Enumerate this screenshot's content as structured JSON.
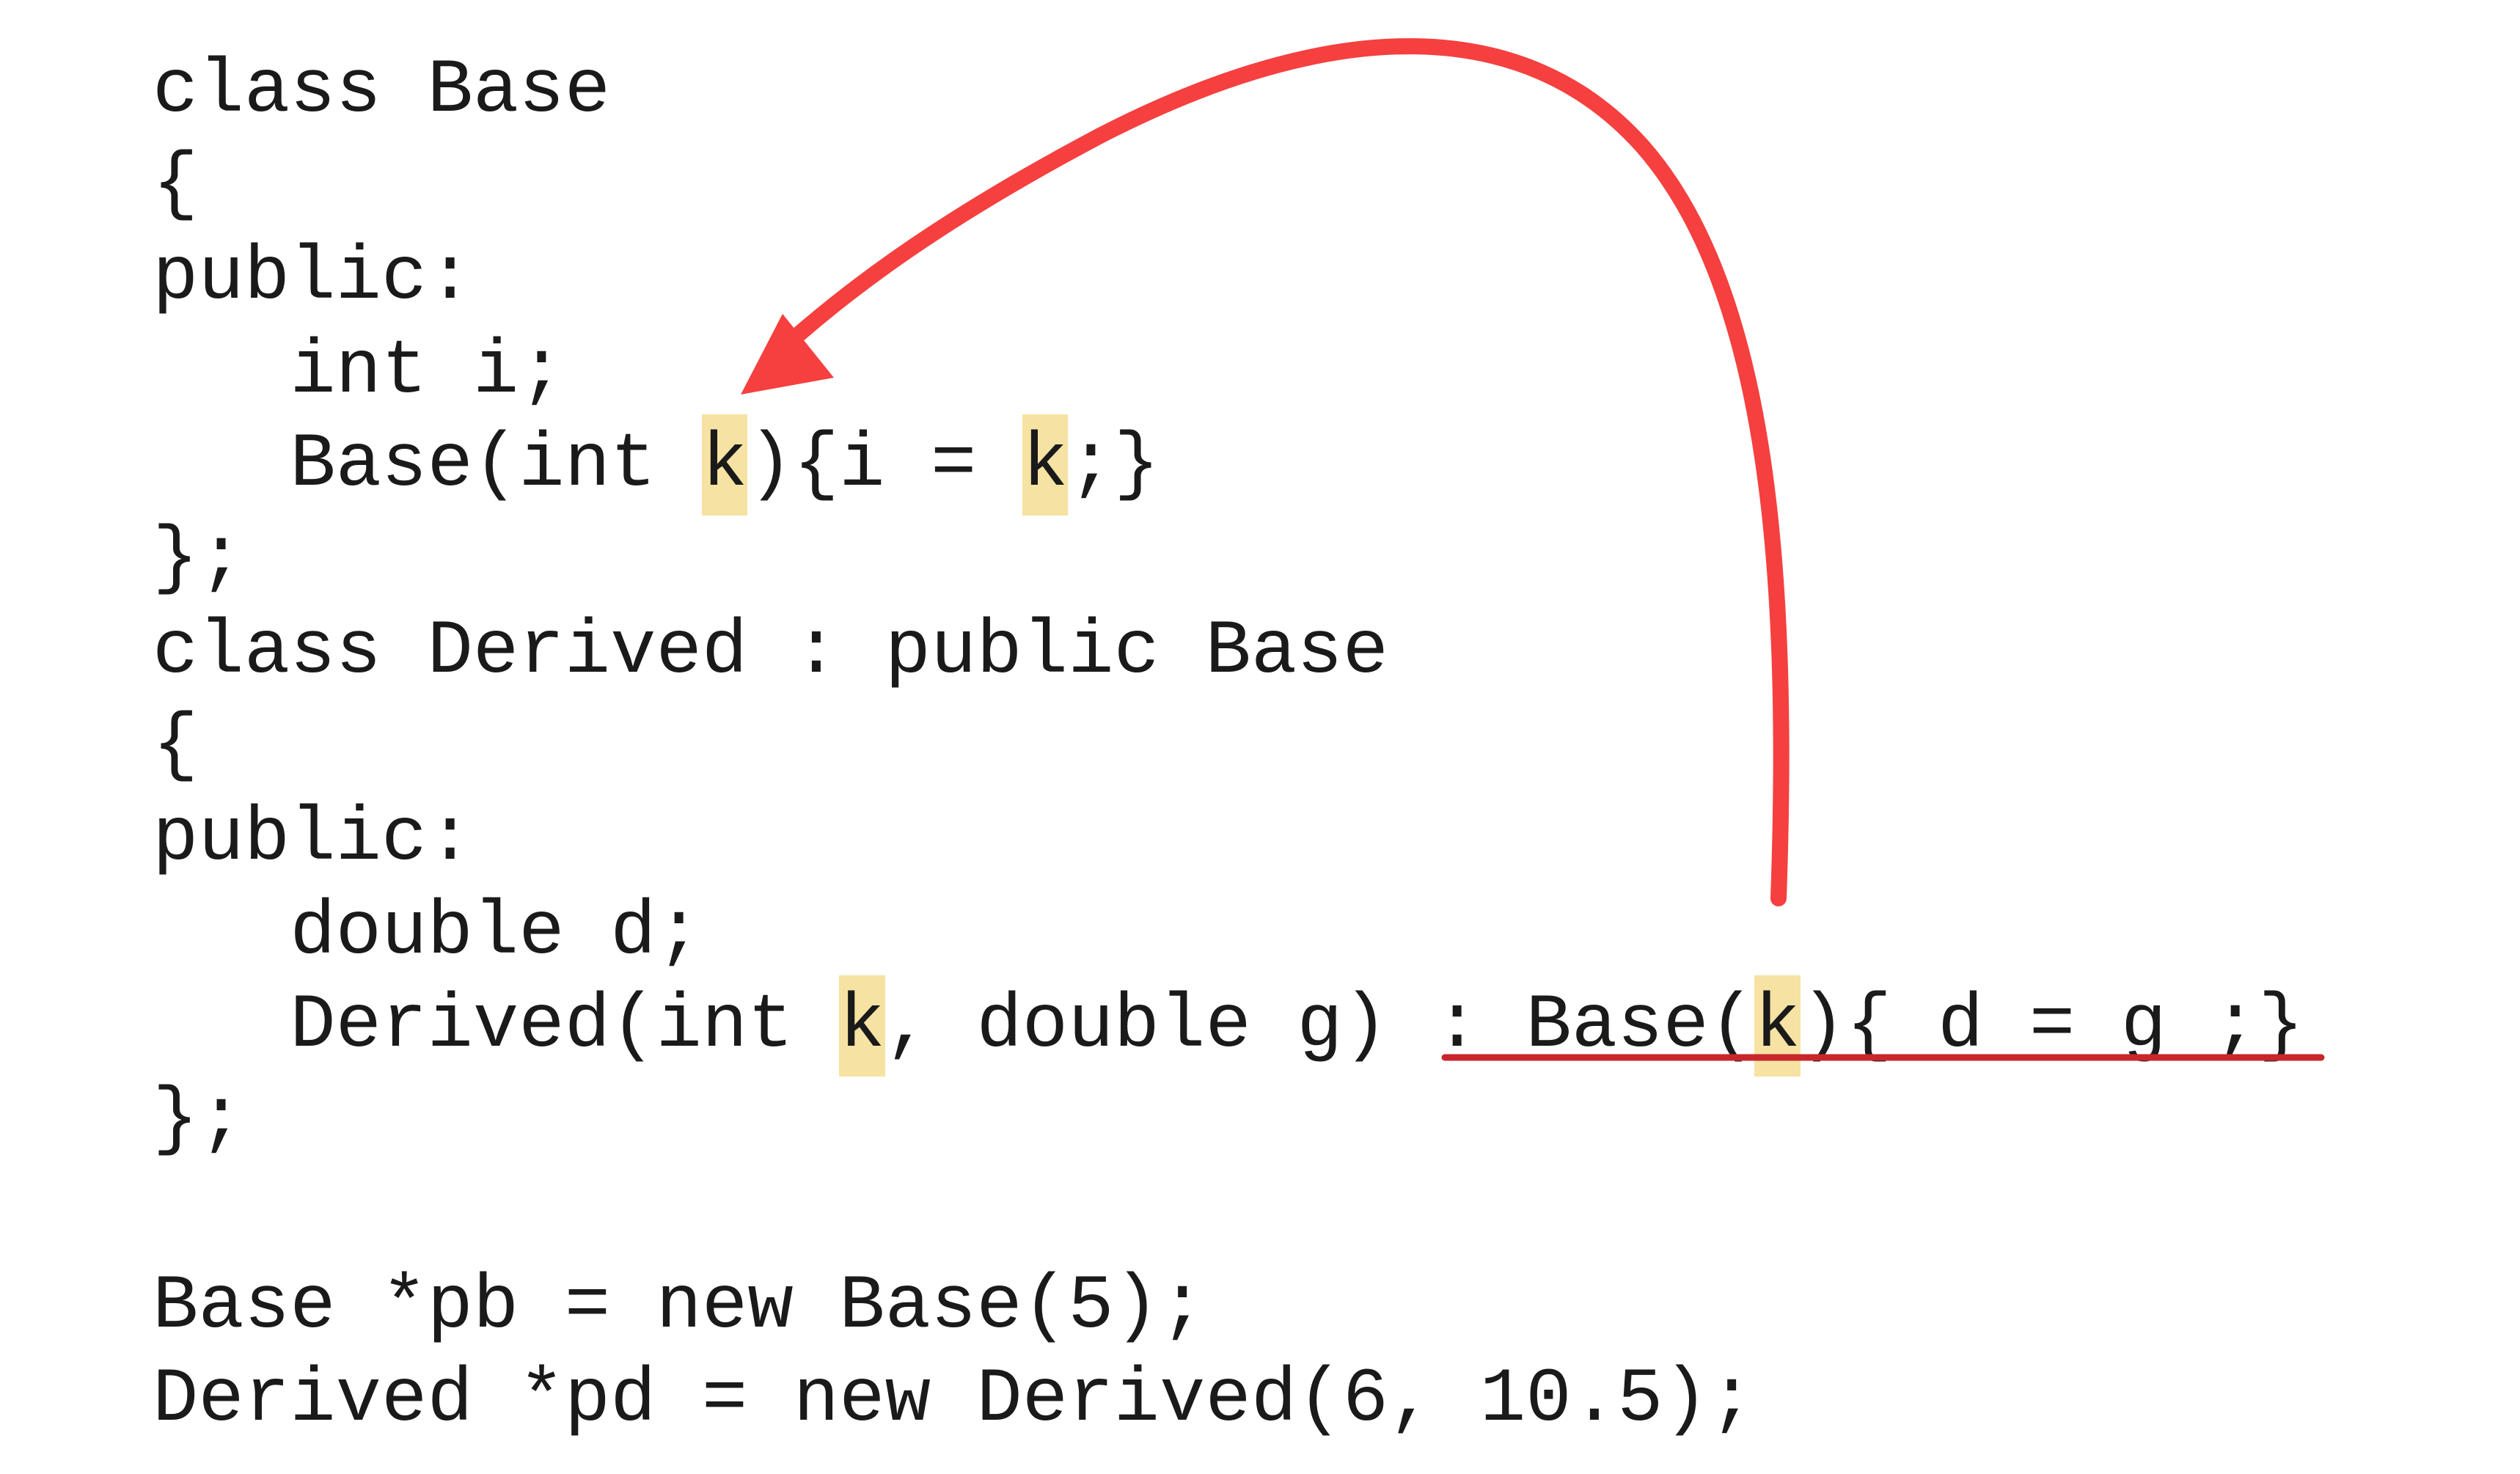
{
  "code": {
    "lines": [
      {
        "segments": [
          {
            "text": "class Base"
          }
        ]
      },
      {
        "segments": [
          {
            "text": "{"
          }
        ]
      },
      {
        "segments": [
          {
            "text": "public:"
          }
        ]
      },
      {
        "segments": [
          {
            "text": "   int i;"
          }
        ]
      },
      {
        "segments": [
          {
            "text": "   Base(int "
          },
          {
            "text": "k",
            "highlight": true
          },
          {
            "text": "){i = "
          },
          {
            "text": "k",
            "highlight": true
          },
          {
            "text": ";}"
          }
        ]
      },
      {
        "segments": [
          {
            "text": "};"
          }
        ]
      },
      {
        "segments": [
          {
            "text": "class Derived : public Base"
          }
        ]
      },
      {
        "segments": [
          {
            "text": "{"
          }
        ]
      },
      {
        "segments": [
          {
            "text": "public:"
          }
        ]
      },
      {
        "segments": [
          {
            "text": "   double d;"
          }
        ]
      },
      {
        "segments": [
          {
            "text": "   Derived(int "
          },
          {
            "text": "k",
            "highlight": true
          },
          {
            "text": ", double g) "
          },
          {
            "text": ": Base(",
            "underline": true
          },
          {
            "text": "k",
            "highlight": true,
            "underline": true
          },
          {
            "text": "){ d = g ;}",
            "underline": true
          }
        ]
      },
      {
        "segments": [
          {
            "text": "};"
          }
        ]
      },
      {
        "segments": [
          {
            "text": ""
          }
        ]
      },
      {
        "segments": [
          {
            "text": "Base *pb = new Base(5);"
          }
        ]
      },
      {
        "segments": [
          {
            "text": "Derived *pd = new Derived(6, 10.5);"
          }
        ]
      }
    ]
  },
  "colors": {
    "text": "#1a1a1a",
    "highlight": "#f6e2a2",
    "arrow": "#f5403f",
    "underline": "#c8262b",
    "background": "#ffffff"
  },
  "annotation": {
    "arrow": {
      "from": "Derived initializer Base(k)",
      "to": "Base constructor parameter k"
    }
  }
}
